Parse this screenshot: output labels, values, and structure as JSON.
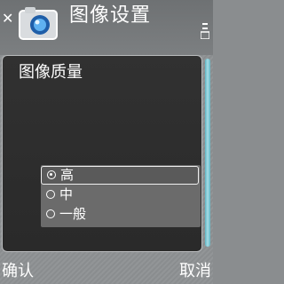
{
  "header": {
    "close_icon": "close-icon",
    "app_icon": "camera-icon",
    "title": "图像设置",
    "menu_icon": "options-menu-icon"
  },
  "setting": {
    "label": "图像质量",
    "options": [
      {
        "label": "高",
        "selected": true
      },
      {
        "label": "中",
        "selected": false
      },
      {
        "label": "一般",
        "selected": false
      }
    ]
  },
  "softkeys": {
    "left": "确认",
    "right": "取消"
  },
  "colors": {
    "panel_bg": "#2e2e2e",
    "list_bg": "#6b6b6b",
    "accent_scroll": "#7cc7d4",
    "text": "#ffffff"
  }
}
